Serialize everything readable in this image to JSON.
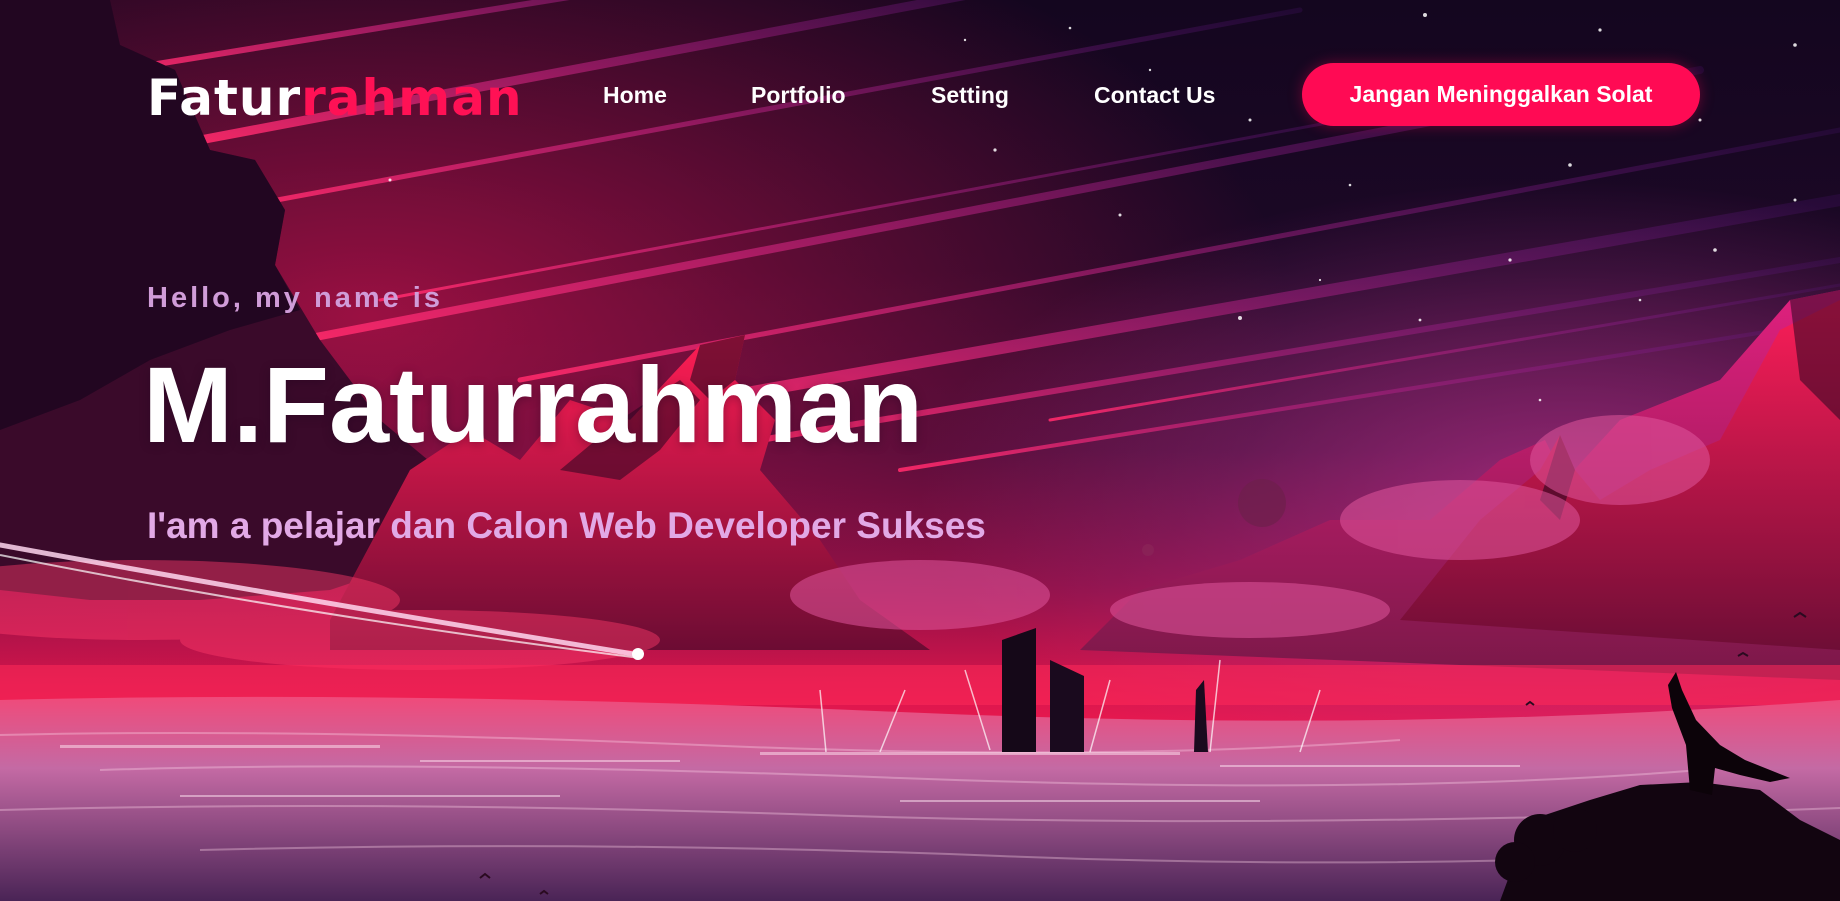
{
  "navbar": {
    "logo_part1": "Fatur",
    "logo_part2": "rahman",
    "links": [
      "Home",
      "Portfolio",
      "Setting",
      "Contact Us"
    ],
    "cta_label": "Jangan Meninggalkan Solat"
  },
  "hero": {
    "greeting": "Hello, my name is",
    "name": "M.Faturrahman",
    "tagline": "I'am a pelajar dan Calon Web Developer Sukses"
  },
  "colors": {
    "accent": "#ff0a54",
    "logo_accent": "#ff1155",
    "greeting": "#d09cd8",
    "tagline": "#e2a9e6",
    "sky_dark": "#14071f"
  }
}
